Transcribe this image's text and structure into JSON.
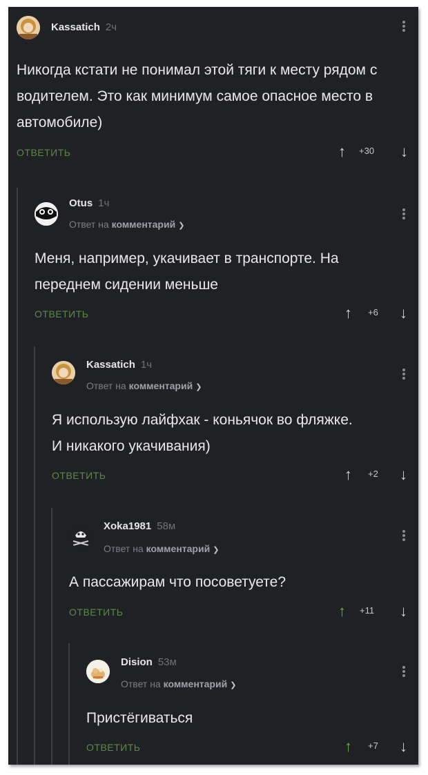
{
  "reply_label": "ОТВЕТИТЬ",
  "reply_to_prefix": "Ответ на",
  "reply_to_target": "комментарий",
  "comments": [
    {
      "username": "Kassatich",
      "time": "2ч",
      "text": "Никогда кстати не понимал этой тяги к месту рядом с водителем. Это как минимум самое опасное место в автомобиле)",
      "score": "+30"
    },
    {
      "username": "Otus",
      "time": "1ч",
      "text": "Меня, например, укачивает в транспорте. На переднем сидении меньше",
      "score": "+6"
    },
    {
      "username": "Kassatich",
      "time": "1ч",
      "text": "Я использую лайфхак - коньячок во фляжке. И никакого укачивания)",
      "score": "+2"
    },
    {
      "username": "Xoka1981",
      "time": "58м",
      "text": "А пассажирам что посоветуете?",
      "score": "+11"
    },
    {
      "username": "Dision",
      "time": "53м",
      "text": "Пристёгиваться",
      "score": "+7"
    }
  ],
  "colors": {
    "background": "#1f2125",
    "reply": "#5c8a46",
    "upvoted": "#69b041"
  }
}
